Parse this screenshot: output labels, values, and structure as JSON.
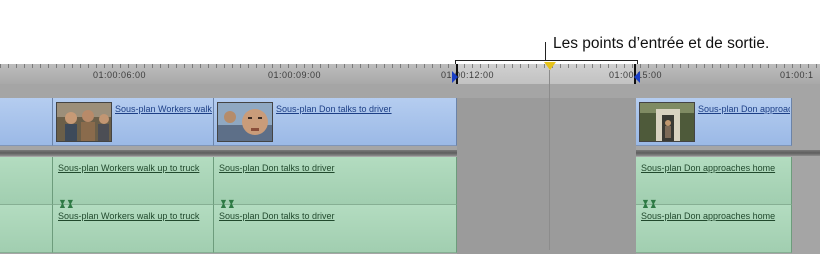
{
  "callout": {
    "text": "Les points d’entrée et de sortie."
  },
  "ruler": {
    "timecodes": [
      "01:00:06:00",
      "01:00:09:00",
      "01:00:12:00",
      "01:00:15:00",
      "01:00:1"
    ]
  },
  "colors": {
    "video_clip": "#a9c4ec",
    "audio_clip": "#aad5b8",
    "in_out_marker": "#1a3fc6",
    "playhead": "#e6c21a"
  },
  "tracks": {
    "video": [
      {
        "label": "Sous-plan Workers walk up to truck",
        "thumb": "workers-thumbnail"
      },
      {
        "label": "Sous-plan Don talks to driver",
        "thumb": "don-thumbnail"
      },
      {
        "label": "Sous-plan Don approaches home",
        "thumb": "home-thumbnail"
      }
    ],
    "audio1": [
      {
        "label": "Sous-plan Workers walk up to truck"
      },
      {
        "label": "Sous-plan Don talks to driver"
      },
      {
        "label": "Sous-plan Don approaches home"
      }
    ],
    "audio2": [
      {
        "label": "Sous-plan Workers walk up to truck"
      },
      {
        "label": "Sous-plan Don talks to driver"
      },
      {
        "label": "Sous-plan Don approaches home"
      }
    ]
  }
}
